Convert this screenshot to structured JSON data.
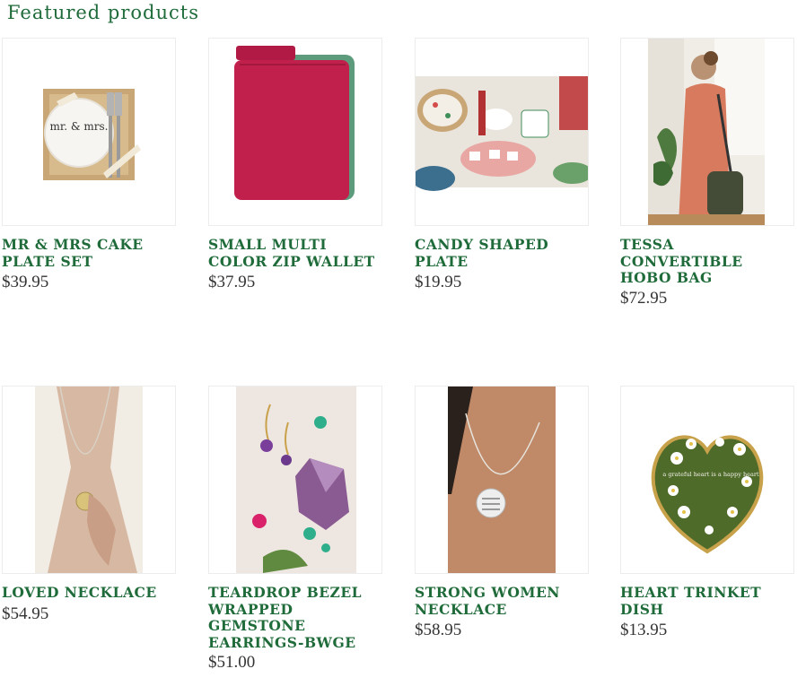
{
  "section": {
    "title": "Featured products"
  },
  "products": [
    {
      "name": "MR & MRS CAKE PLATE SET",
      "price": "$39.95",
      "image": "cake-plate-set"
    },
    {
      "name": "SMALL MULTI COLOR ZIP WALLET",
      "price": "$37.95",
      "image": "zip-wallet"
    },
    {
      "name": "CANDY SHAPED PLATE",
      "price": "$19.95",
      "image": "candy-plates"
    },
    {
      "name": "TESSA CONVERTIBLE HOBO BAG",
      "price": "$72.95",
      "image": "hobo-bag"
    },
    {
      "name": "LOVED NECKLACE",
      "price": "$54.95",
      "image": "loved-necklace"
    },
    {
      "name": "TEARDROP BEZEL WRAPPED GEMSTONE EARRINGS-BWGE",
      "price": "$51.00",
      "image": "gemstone-earrings"
    },
    {
      "name": "STRONG WOMEN NECKLACE",
      "price": "$58.95",
      "image": "strong-women-necklace"
    },
    {
      "name": "HEART TRINKET DISH",
      "price": "$13.95",
      "image": "heart-trinket-dish"
    }
  ],
  "image_text": {
    "plate": "mr. & mrs.",
    "dish": "a grateful heart is a happy heart"
  },
  "colors": {
    "title_green": "#1f6b3a",
    "price_gray": "#333333",
    "wallet_pink": "#c2204c",
    "wallet_green": "#5c9b7c",
    "bag_olive": "#444c38",
    "dish_green": "#4f6b2a"
  }
}
